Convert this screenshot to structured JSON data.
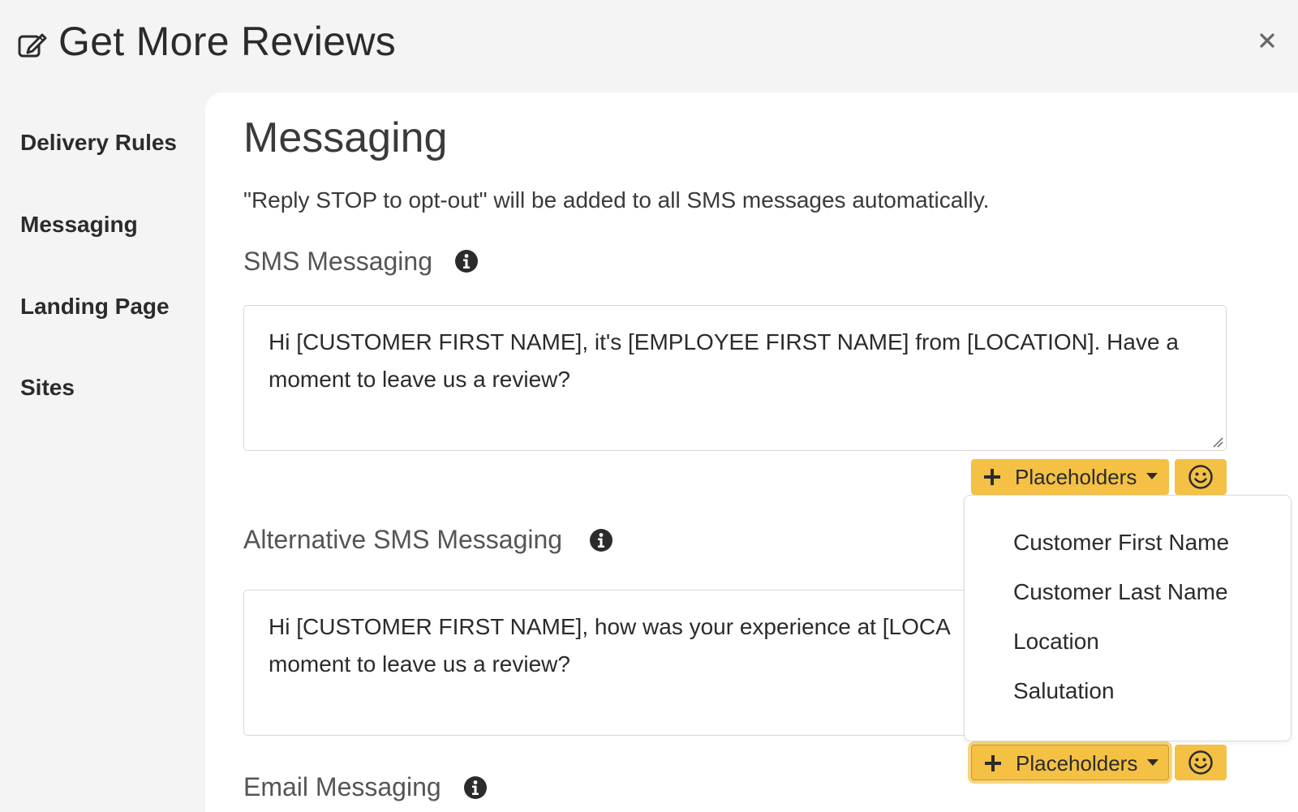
{
  "header": {
    "title": "Get More Reviews",
    "edit_icon": "edit-icon",
    "close_icon": "close-icon"
  },
  "sidebar": {
    "items": [
      {
        "label": "Delivery Rules"
      },
      {
        "label": "Messaging"
      },
      {
        "label": "Landing Page"
      },
      {
        "label": "Sites"
      }
    ]
  },
  "main": {
    "title": "Messaging",
    "note": "\"Reply STOP to opt-out\" will be added to all SMS messages automatically.",
    "sms": {
      "label": "SMS Messaging",
      "value": "Hi [CUSTOMER FIRST NAME], it's [EMPLOYEE FIRST NAME] from [LOCATION]. Have a moment to leave us a review?"
    },
    "alt_sms": {
      "label": "Alternative SMS Messaging",
      "value": "Hi [CUSTOMER FIRST NAME], how was your experience at [LOCA",
      "value_line2": "moment to leave us a review?"
    },
    "email": {
      "label": "Email Messaging"
    },
    "placeholders_label": "Placeholders",
    "dropdown": {
      "options": [
        "Customer First Name",
        "Customer Last Name",
        "Location",
        "Salutation"
      ]
    }
  },
  "colors": {
    "accent": "#f4c145",
    "background": "#f3f4f3",
    "panel": "#ffffff"
  }
}
